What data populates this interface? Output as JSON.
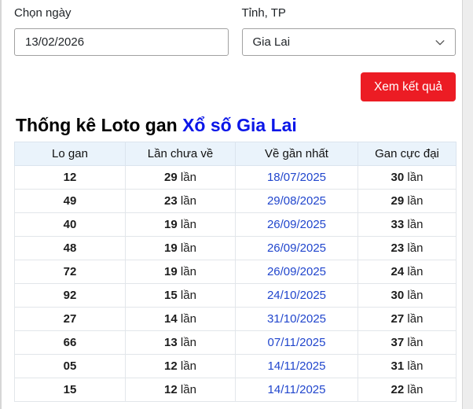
{
  "controls": {
    "date_label": "Chọn ngày",
    "date_value": "13/02/2026",
    "province_label": "Tỉnh, TP",
    "province_value": "Gia Lai",
    "submit_label": "Xem kết quả"
  },
  "title": {
    "prefix": "Thống kê Loto gan ",
    "link": "Xổ số Gia Lai"
  },
  "table": {
    "headers": [
      "Lo gan",
      "Lần chưa về",
      "Về gần nhất",
      "Gan cực đại"
    ],
    "count_suffix": "lần",
    "rows": [
      {
        "number": "12",
        "missed": "29",
        "last_date": "18/07/2025",
        "max_gan": "30"
      },
      {
        "number": "49",
        "missed": "23",
        "last_date": "29/08/2025",
        "max_gan": "29"
      },
      {
        "number": "40",
        "missed": "19",
        "last_date": "26/09/2025",
        "max_gan": "33"
      },
      {
        "number": "48",
        "missed": "19",
        "last_date": "26/09/2025",
        "max_gan": "23"
      },
      {
        "number": "72",
        "missed": "19",
        "last_date": "26/09/2025",
        "max_gan": "24"
      },
      {
        "number": "92",
        "missed": "15",
        "last_date": "24/10/2025",
        "max_gan": "30"
      },
      {
        "number": "27",
        "missed": "14",
        "last_date": "31/10/2025",
        "max_gan": "27"
      },
      {
        "number": "66",
        "missed": "13",
        "last_date": "07/11/2025",
        "max_gan": "37"
      },
      {
        "number": "05",
        "missed": "12",
        "last_date": "14/11/2025",
        "max_gan": "31"
      },
      {
        "number": "15",
        "missed": "12",
        "last_date": "14/11/2025",
        "max_gan": "22"
      }
    ]
  },
  "colors": {
    "accent_red": "#ec1c24",
    "header_bg": "#eaf3fb",
    "link_blue": "#2146cd",
    "title_link_blue": "#0b16e8"
  },
  "icons": {
    "chevron_down": "chevron-down-icon"
  }
}
